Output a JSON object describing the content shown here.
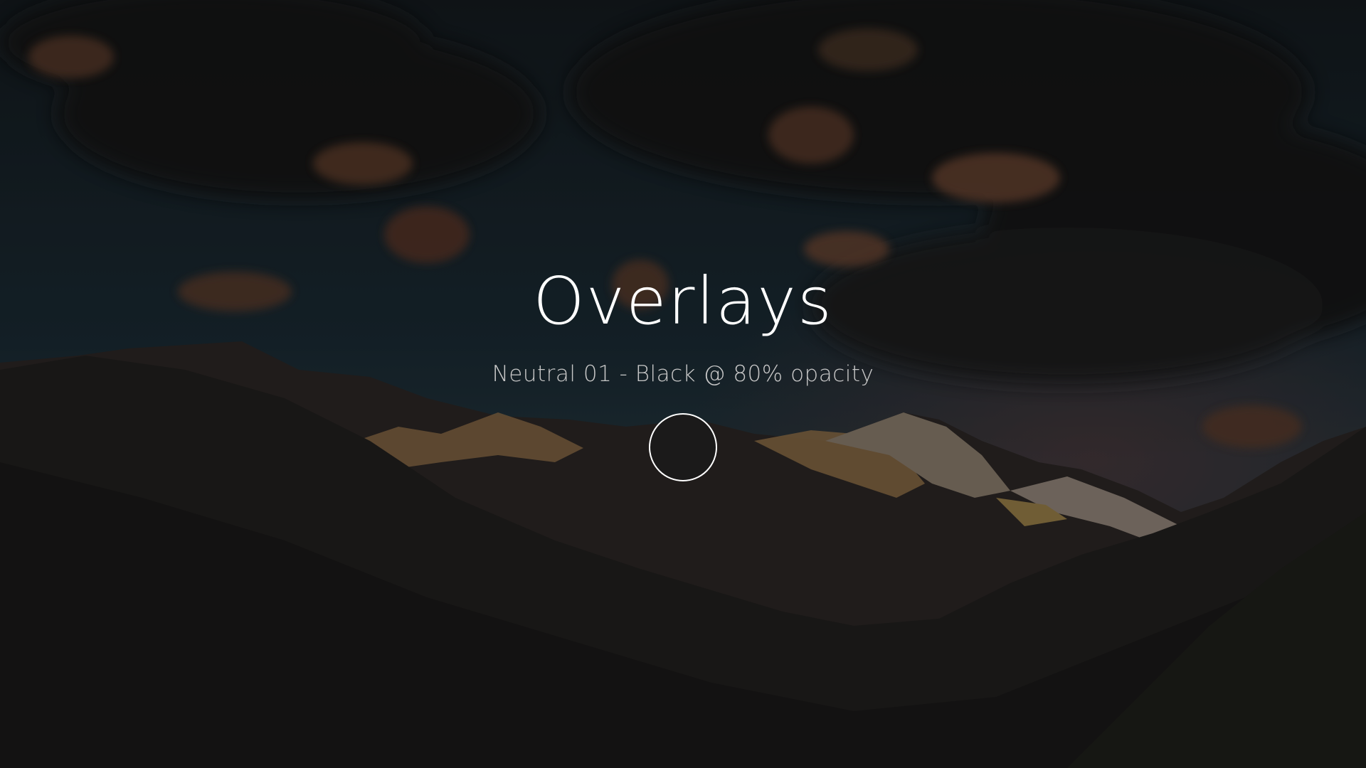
{
  "slide": {
    "title": "Overlays",
    "subtitle": "Neutral 01 - Black @ 80% opacity"
  },
  "swatch": {
    "color": "#1b1a1a",
    "border_color": "#ffffff"
  },
  "colors": {
    "title": "#ffffff",
    "subtitle": "#c8c8c8",
    "overlay_tint": "#000000"
  },
  "overlay": {
    "opacity": 0.8
  }
}
